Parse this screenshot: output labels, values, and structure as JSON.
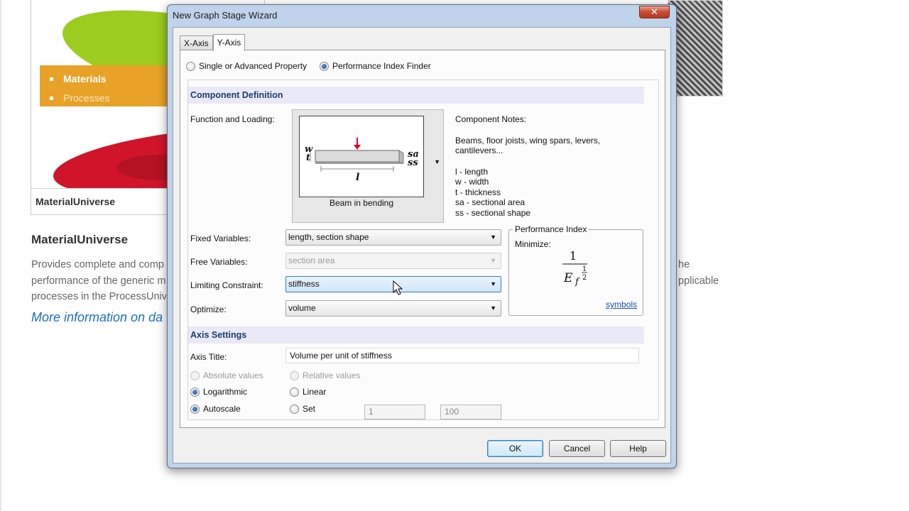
{
  "background": {
    "menu_items": [
      "Materials",
      "Processes"
    ],
    "card_footer": "MaterialUniverse",
    "heading": "MaterialUniverse",
    "paragraph_lines": [
      "Provides complete and comp",
      "performance of the generic m",
      "processes in the ProcessUnive"
    ],
    "link_text": "More information on da",
    "right_lines": [
      "he",
      "pplicable"
    ]
  },
  "dialog": {
    "title": "New Graph Stage Wizard",
    "close_glyph": "✕",
    "tabs": [
      {
        "label": "X-Axis",
        "active": false
      },
      {
        "label": "Y-Axis",
        "active": true
      }
    ],
    "mode_options": [
      {
        "label": "Single or Advanced Property",
        "selected": false
      },
      {
        "label": "Performance Index Finder",
        "selected": true
      }
    ],
    "component_definition": {
      "header": "Component Definition",
      "function_label": "Function and Loading:",
      "preview_caption": "Beam in bending",
      "notes_title": "Component Notes:",
      "notes_body_lines": [
        "Beams, floor joists, wing spars, levers,",
        "cantilevers..."
      ],
      "notes_vars": [
        "l - length",
        "w - width",
        "t - thickness",
        "sa - sectional area",
        "ss - sectional shape"
      ],
      "diagram_labels": {
        "w": "w",
        "t": "t",
        "l": "l",
        "sa": "sa",
        "ss": "ss"
      },
      "fixed_label": "Fixed Variables:",
      "fixed_value": "length, section shape",
      "free_label": "Free Variables:",
      "free_value": "section area",
      "constraint_label": "Limiting Constraint:",
      "constraint_value": "stiffness",
      "optimize_label": "Optimize:",
      "optimize_value": "volume",
      "performance_index": {
        "legend": "Performance Index",
        "minimize_label": "Minimize:",
        "numerator": "1",
        "base": "E",
        "subscript": "f",
        "exp_num": "1",
        "exp_den": "2",
        "symbols_link": "symbols"
      }
    },
    "axis_settings": {
      "header": "Axis Settings",
      "title_label": "Axis Title:",
      "title_value": "Volume per unit of stiffness",
      "absolute_label": "Absolute values",
      "relative_label": "Relative values",
      "log_label": "Logarithmic",
      "linear_label": "Linear",
      "autoscale_label": "Autoscale",
      "set_label": "Set",
      "min_value": "1",
      "max_value": "100"
    },
    "buttons": {
      "ok": "OK",
      "cancel": "Cancel",
      "help": "Help"
    }
  }
}
